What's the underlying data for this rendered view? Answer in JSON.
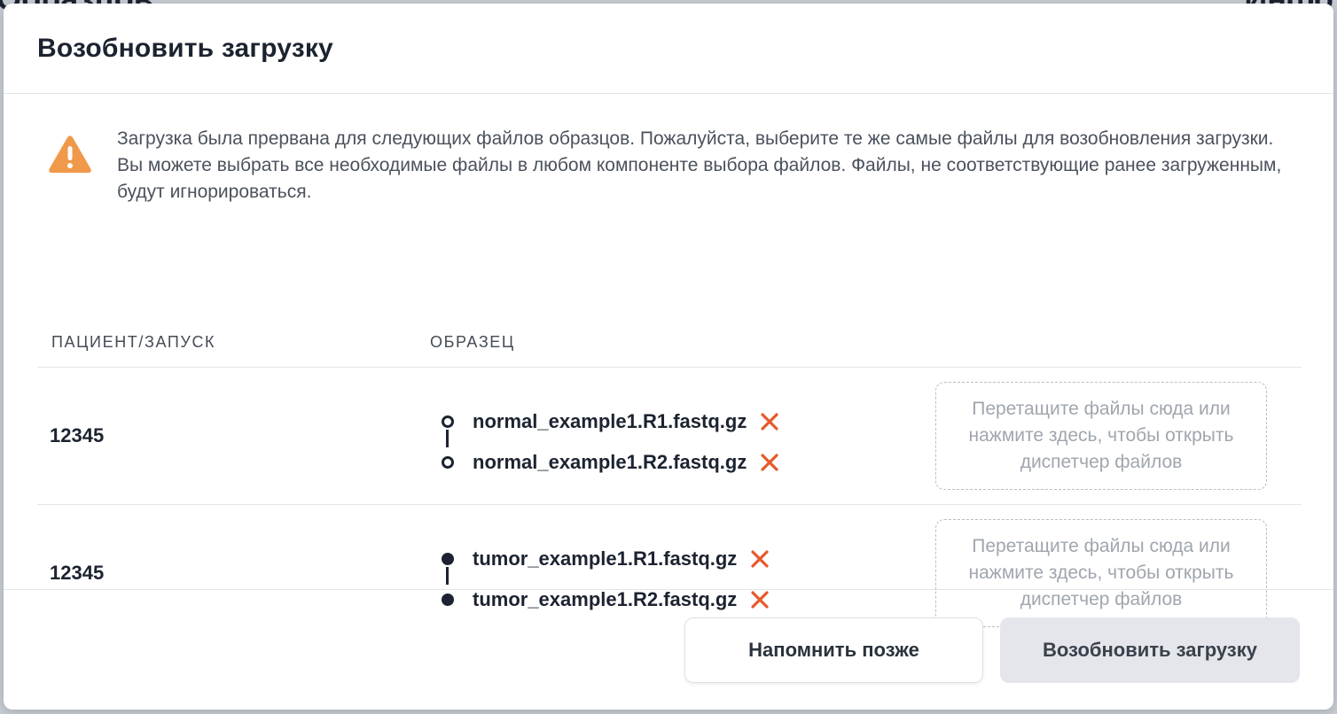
{
  "background": {
    "title_left": "Образцов",
    "title_right": "Инфо"
  },
  "modal": {
    "title": "Возобновить загрузку",
    "alert": {
      "icon": "warning-triangle-icon",
      "icon_color": "#f0994a",
      "text": "Загрузка была прервана для следующих файлов образцов. Пожалуйста, выберите те же самые файлы для возобновления загрузки. Вы можете выбрать все необходимые файлы в любом компоненте выбора файлов. Файлы, не соответствующие ранее загруженным, будут игнорироваться."
    },
    "table": {
      "columns": [
        "ПАЦИЕНТ/ЗАПУСК",
        "ОБРАЗЕЦ"
      ],
      "rows": [
        {
          "patient": "12345",
          "sample_type": "normal",
          "files": [
            "normal_example1.R1.fastq.gz",
            "normal_example1.R2.fastq.gz"
          ],
          "dropzone": "Перетащите файлы сюда или нажмите здесь, чтобы открыть диспетчер файлов"
        },
        {
          "patient": "12345",
          "sample_type": "tumor",
          "files": [
            "tumor_example1.R1.fastq.gz",
            "tumor_example1.R2.fastq.gz"
          ],
          "dropzone": "Перетащите файлы сюда или нажмите здесь, чтобы открыть диспетчер файлов"
        }
      ]
    },
    "footer": {
      "remind_later": "Напомнить позже",
      "resume": "Возобновить загрузку"
    },
    "colors": {
      "remove_icon": "#e8582a",
      "primary_text": "#1c2330"
    }
  }
}
